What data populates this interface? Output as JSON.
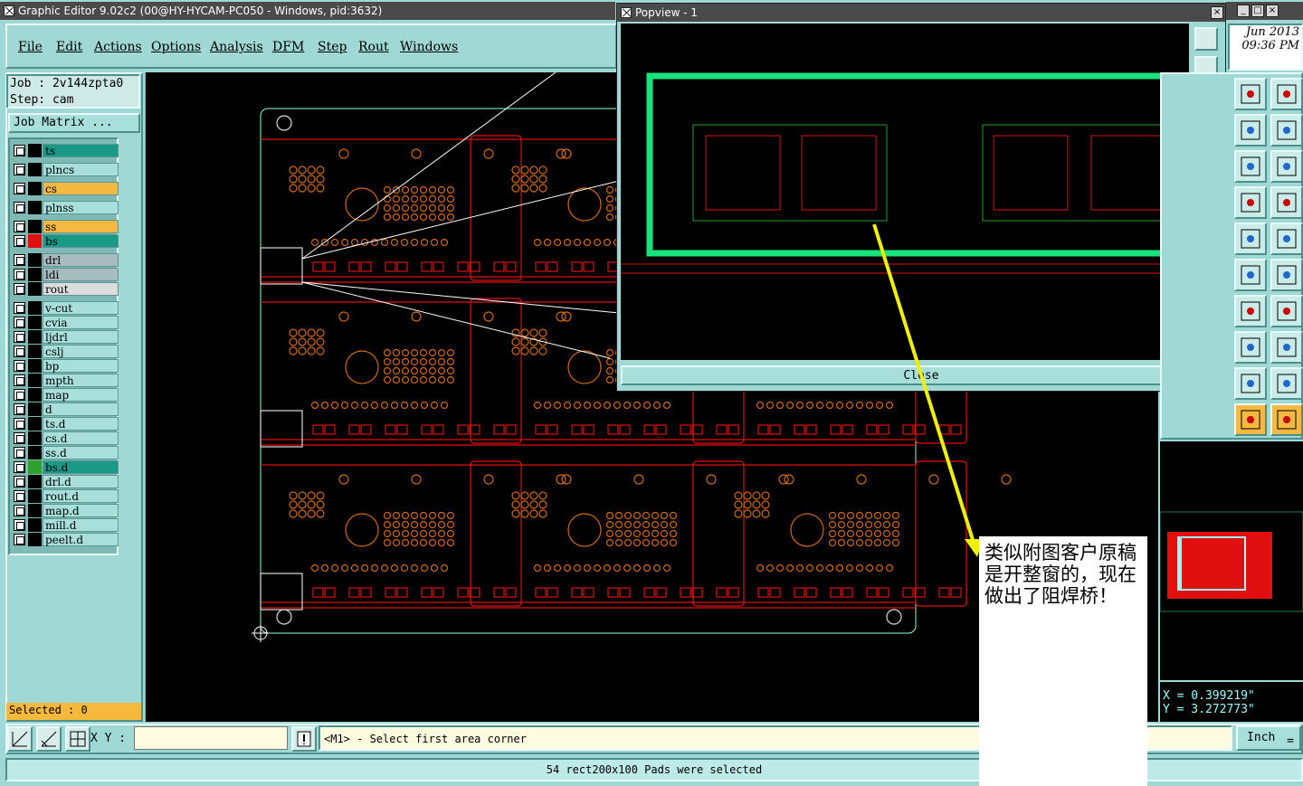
{
  "main_window": {
    "title": "Graphic Editor 9.02c2 (00@HY-HYCAM-PC050 - Windows, pid:3632)"
  },
  "menu": [
    {
      "label": "File"
    },
    {
      "label": "Edit"
    },
    {
      "label": "Actions"
    },
    {
      "label": "Options"
    },
    {
      "label": "Analysis"
    },
    {
      "label": "DFM"
    },
    {
      "label": "Step"
    },
    {
      "label": "Rout"
    },
    {
      "label": "Windows"
    }
  ],
  "job": {
    "job_line": "Job : 2v144zpta0",
    "step_line": "Step: cam",
    "matrix_button": "Job Matrix ..."
  },
  "layers": [
    {
      "name": "ts",
      "color": "#1a9a86",
      "swatch": "#000000"
    },
    {
      "name": "plncs",
      "color": "#a9dfdb",
      "swatch": "#000000"
    },
    {
      "name": "cs",
      "color": "#f5b942",
      "swatch": "#000000"
    },
    {
      "name": "plnss",
      "color": "#a9dfdb",
      "swatch": "#000000"
    },
    {
      "name": "ss",
      "color": "#f5b942",
      "swatch": "#000000"
    },
    {
      "name": "bs",
      "color": "#1a9a86",
      "swatch": "#e01010"
    },
    {
      "name": "drl",
      "color": "#a8bcc0",
      "swatch": "#000000"
    },
    {
      "name": "ldi",
      "color": "#a8bcc0",
      "swatch": "#000000"
    },
    {
      "name": "rout",
      "color": "#dcdcdc",
      "swatch": "#000000"
    },
    {
      "name": "v-cut",
      "color": "#a9dfdb",
      "swatch": "#000000"
    },
    {
      "name": "cvia",
      "color": "#a9dfdb",
      "swatch": "#000000"
    },
    {
      "name": "ljdrl",
      "color": "#a9dfdb",
      "swatch": "#000000"
    },
    {
      "name": "cslj",
      "color": "#a9dfdb",
      "swatch": "#000000"
    },
    {
      "name": "bp",
      "color": "#a9dfdb",
      "swatch": "#000000"
    },
    {
      "name": "mpth",
      "color": "#a9dfdb",
      "swatch": "#000000"
    },
    {
      "name": "map",
      "color": "#a9dfdb",
      "swatch": "#000000"
    },
    {
      "name": "d",
      "color": "#a9dfdb",
      "swatch": "#000000"
    },
    {
      "name": "ts.d",
      "color": "#a9dfdb",
      "swatch": "#000000"
    },
    {
      "name": "cs.d",
      "color": "#a9dfdb",
      "swatch": "#000000"
    },
    {
      "name": "ss.d",
      "color": "#a9dfdb",
      "swatch": "#000000"
    },
    {
      "name": "bs.d",
      "color": "#1a9a86",
      "swatch": "#2ea02e"
    },
    {
      "name": "drl.d",
      "color": "#a9dfdb",
      "swatch": "#000000"
    },
    {
      "name": "rout.d",
      "color": "#a9dfdb",
      "swatch": "#000000"
    },
    {
      "name": "map.d",
      "color": "#a9dfdb",
      "swatch": "#000000"
    },
    {
      "name": "mill.d",
      "color": "#a9dfdb",
      "swatch": "#000000"
    },
    {
      "name": "peelt.d",
      "color": "#a9dfdb",
      "swatch": "#000000"
    }
  ],
  "selected_count": "Selected : 0",
  "popview": {
    "title": "Popview - 1",
    "close_label": "Close"
  },
  "datetime": {
    "date": "Jun 2013",
    "time": "09:36 PM"
  },
  "coords": {
    "x": "X = 0.399219\"",
    "y": "Y = 3.272773\""
  },
  "bottom": {
    "xy_label": "X Y :",
    "command": "<M1> - Select first area corner",
    "units": "Inch"
  },
  "status": "54 rect200x100 Pads were selected",
  "annotation": "类似附图客户原稿是开整窗的，现在做出了阻焊桥！",
  "colors": {
    "accent": "#9fd8d4",
    "copper": "#e01010",
    "silk": "#d06a10",
    "highlight": "#18e27a",
    "arrow": "#f0f000"
  }
}
